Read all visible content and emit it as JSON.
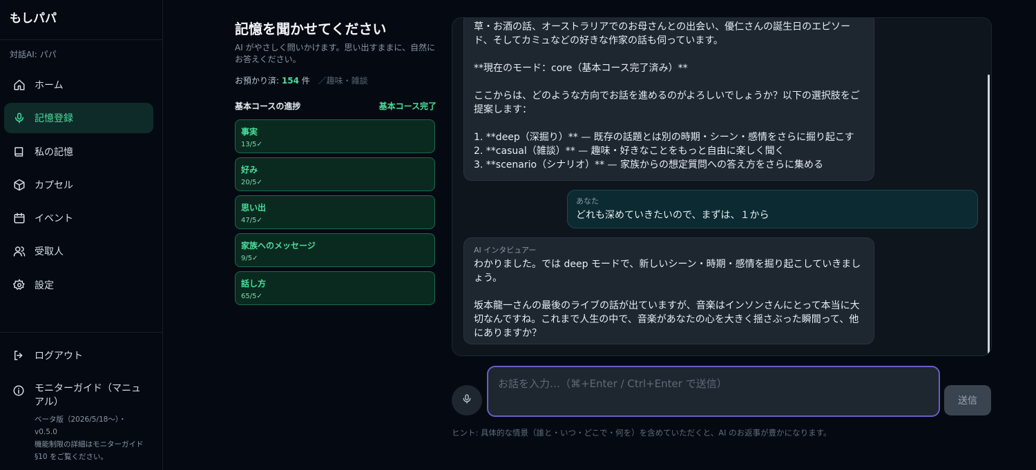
{
  "sidebar": {
    "brand": "もしパパ",
    "subtitle": "対話AI: パパ",
    "items": [
      {
        "label": "ホーム",
        "icon": "home-icon"
      },
      {
        "label": "記憶登録",
        "icon": "mic-icon",
        "active": true
      },
      {
        "label": "私の記憶",
        "icon": "book-icon"
      },
      {
        "label": "カプセル",
        "icon": "box-icon"
      },
      {
        "label": "イベント",
        "icon": "calendar-icon"
      },
      {
        "label": "受取人",
        "icon": "users-icon"
      },
      {
        "label": "設定",
        "icon": "gear-icon"
      }
    ],
    "logout": "ログアウト",
    "guide": {
      "title": "モニターガイド（マニュアル）",
      "note": "ベータ版（2026/5/18〜）・v0.5.0\n機能制限の詳細はモニターガイド §10 をご覧ください。"
    }
  },
  "panel": {
    "title": "記憶を聞かせてください",
    "desc": "AI がやさしく問いかけます。思い出すままに、自然にお答えください。",
    "stored_prefix": "お預かり済:",
    "stored_count": "154",
    "stored_unit": "件",
    "stored_tag": "／趣味・雑談",
    "progress_label": "基本コースの進捗",
    "progress_status": "基本コース完了",
    "cards": [
      {
        "name": "事実",
        "progress": "13/5✓"
      },
      {
        "name": "好み",
        "progress": "20/5✓"
      },
      {
        "name": "思い出",
        "progress": "47/5✓"
      },
      {
        "name": "家族へのメッセージ",
        "progress": "9/5✓"
      },
      {
        "name": "話し方",
        "progress": "65/5✓"
      }
    ]
  },
  "chat": {
    "msg1": {
      "p1": "草・お酒の話、オーストラリアでのお母さんとの出会い、優仁さんの誕生日のエピソード、そしてカミュなどの好きな作家の話も伺っています。",
      "p2": "**現在のモード：core（基本コース完了済み）**",
      "p3": "ここからは、どのような方向でお話を進めるのがよろしいでしょうか？以下の選択肢をご提案します：",
      "opt1": "1. **deep（深掘り）** — 既存の話題とは別の時期・シーン・感情をさらに掘り起こす",
      "opt2": "2. **casual（雑談）** — 趣味・好きなことをもっと自由に楽しく聞く",
      "opt3": "3. **scenario（シナリオ）** — 家族からの想定質問への答え方をさらに集める"
    },
    "msg2": {
      "who": "あなた",
      "text": "どれも深めていきたいので、まずは、１から"
    },
    "msg3": {
      "who": "AI インタビュアー",
      "p1": "わかりました。では deep モードで、新しいシーン・時期・感情を掘り起こしていきましょう。",
      "p2": "坂本龍一さんの最後のライブの話が出ていますが、音楽はインソンさんにとって本当に大切なんですね。これまで人生の中で、音楽があなたの心を大きく揺さぶった瞬間って、他にありますか？"
    }
  },
  "composer": {
    "placeholder": "お話を入力…（⌘+Enter / Ctrl+Enter で送信）",
    "send": "送信",
    "hint": "ヒント: 具体的な情景（誰と・いつ・どこで・何を）を含めていただくと、AI のお返事が豊かになります。"
  },
  "colors": {
    "accent": "#4ade9c",
    "background": "#050a12",
    "input_border": "#6b5fc7"
  }
}
